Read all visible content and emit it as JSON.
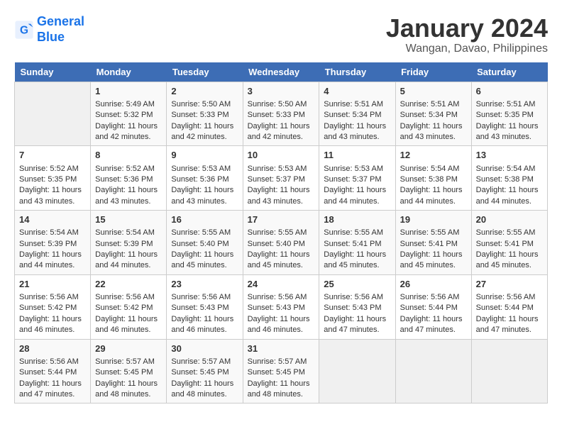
{
  "header": {
    "logo_line1": "General",
    "logo_line2": "Blue",
    "title": "January 2024",
    "subtitle": "Wangan, Davao, Philippines"
  },
  "days_of_week": [
    "Sunday",
    "Monday",
    "Tuesday",
    "Wednesday",
    "Thursday",
    "Friday",
    "Saturday"
  ],
  "weeks": [
    [
      {
        "day": "",
        "info": ""
      },
      {
        "day": "1",
        "info": "Sunrise: 5:49 AM\nSunset: 5:32 PM\nDaylight: 11 hours\nand 42 minutes."
      },
      {
        "day": "2",
        "info": "Sunrise: 5:50 AM\nSunset: 5:33 PM\nDaylight: 11 hours\nand 42 minutes."
      },
      {
        "day": "3",
        "info": "Sunrise: 5:50 AM\nSunset: 5:33 PM\nDaylight: 11 hours\nand 42 minutes."
      },
      {
        "day": "4",
        "info": "Sunrise: 5:51 AM\nSunset: 5:34 PM\nDaylight: 11 hours\nand 43 minutes."
      },
      {
        "day": "5",
        "info": "Sunrise: 5:51 AM\nSunset: 5:34 PM\nDaylight: 11 hours\nand 43 minutes."
      },
      {
        "day": "6",
        "info": "Sunrise: 5:51 AM\nSunset: 5:35 PM\nDaylight: 11 hours\nand 43 minutes."
      }
    ],
    [
      {
        "day": "7",
        "info": "Sunrise: 5:52 AM\nSunset: 5:35 PM\nDaylight: 11 hours\nand 43 minutes."
      },
      {
        "day": "8",
        "info": "Sunrise: 5:52 AM\nSunset: 5:36 PM\nDaylight: 11 hours\nand 43 minutes."
      },
      {
        "day": "9",
        "info": "Sunrise: 5:53 AM\nSunset: 5:36 PM\nDaylight: 11 hours\nand 43 minutes."
      },
      {
        "day": "10",
        "info": "Sunrise: 5:53 AM\nSunset: 5:37 PM\nDaylight: 11 hours\nand 43 minutes."
      },
      {
        "day": "11",
        "info": "Sunrise: 5:53 AM\nSunset: 5:37 PM\nDaylight: 11 hours\nand 44 minutes."
      },
      {
        "day": "12",
        "info": "Sunrise: 5:54 AM\nSunset: 5:38 PM\nDaylight: 11 hours\nand 44 minutes."
      },
      {
        "day": "13",
        "info": "Sunrise: 5:54 AM\nSunset: 5:38 PM\nDaylight: 11 hours\nand 44 minutes."
      }
    ],
    [
      {
        "day": "14",
        "info": "Sunrise: 5:54 AM\nSunset: 5:39 PM\nDaylight: 11 hours\nand 44 minutes."
      },
      {
        "day": "15",
        "info": "Sunrise: 5:54 AM\nSunset: 5:39 PM\nDaylight: 11 hours\nand 44 minutes."
      },
      {
        "day": "16",
        "info": "Sunrise: 5:55 AM\nSunset: 5:40 PM\nDaylight: 11 hours\nand 45 minutes."
      },
      {
        "day": "17",
        "info": "Sunrise: 5:55 AM\nSunset: 5:40 PM\nDaylight: 11 hours\nand 45 minutes."
      },
      {
        "day": "18",
        "info": "Sunrise: 5:55 AM\nSunset: 5:41 PM\nDaylight: 11 hours\nand 45 minutes."
      },
      {
        "day": "19",
        "info": "Sunrise: 5:55 AM\nSunset: 5:41 PM\nDaylight: 11 hours\nand 45 minutes."
      },
      {
        "day": "20",
        "info": "Sunrise: 5:55 AM\nSunset: 5:41 PM\nDaylight: 11 hours\nand 45 minutes."
      }
    ],
    [
      {
        "day": "21",
        "info": "Sunrise: 5:56 AM\nSunset: 5:42 PM\nDaylight: 11 hours\nand 46 minutes."
      },
      {
        "day": "22",
        "info": "Sunrise: 5:56 AM\nSunset: 5:42 PM\nDaylight: 11 hours\nand 46 minutes."
      },
      {
        "day": "23",
        "info": "Sunrise: 5:56 AM\nSunset: 5:43 PM\nDaylight: 11 hours\nand 46 minutes."
      },
      {
        "day": "24",
        "info": "Sunrise: 5:56 AM\nSunset: 5:43 PM\nDaylight: 11 hours\nand 46 minutes."
      },
      {
        "day": "25",
        "info": "Sunrise: 5:56 AM\nSunset: 5:43 PM\nDaylight: 11 hours\nand 47 minutes."
      },
      {
        "day": "26",
        "info": "Sunrise: 5:56 AM\nSunset: 5:44 PM\nDaylight: 11 hours\nand 47 minutes."
      },
      {
        "day": "27",
        "info": "Sunrise: 5:56 AM\nSunset: 5:44 PM\nDaylight: 11 hours\nand 47 minutes."
      }
    ],
    [
      {
        "day": "28",
        "info": "Sunrise: 5:56 AM\nSunset: 5:44 PM\nDaylight: 11 hours\nand 47 minutes."
      },
      {
        "day": "29",
        "info": "Sunrise: 5:57 AM\nSunset: 5:45 PM\nDaylight: 11 hours\nand 48 minutes."
      },
      {
        "day": "30",
        "info": "Sunrise: 5:57 AM\nSunset: 5:45 PM\nDaylight: 11 hours\nand 48 minutes."
      },
      {
        "day": "31",
        "info": "Sunrise: 5:57 AM\nSunset: 5:45 PM\nDaylight: 11 hours\nand 48 minutes."
      },
      {
        "day": "",
        "info": ""
      },
      {
        "day": "",
        "info": ""
      },
      {
        "day": "",
        "info": ""
      }
    ]
  ]
}
